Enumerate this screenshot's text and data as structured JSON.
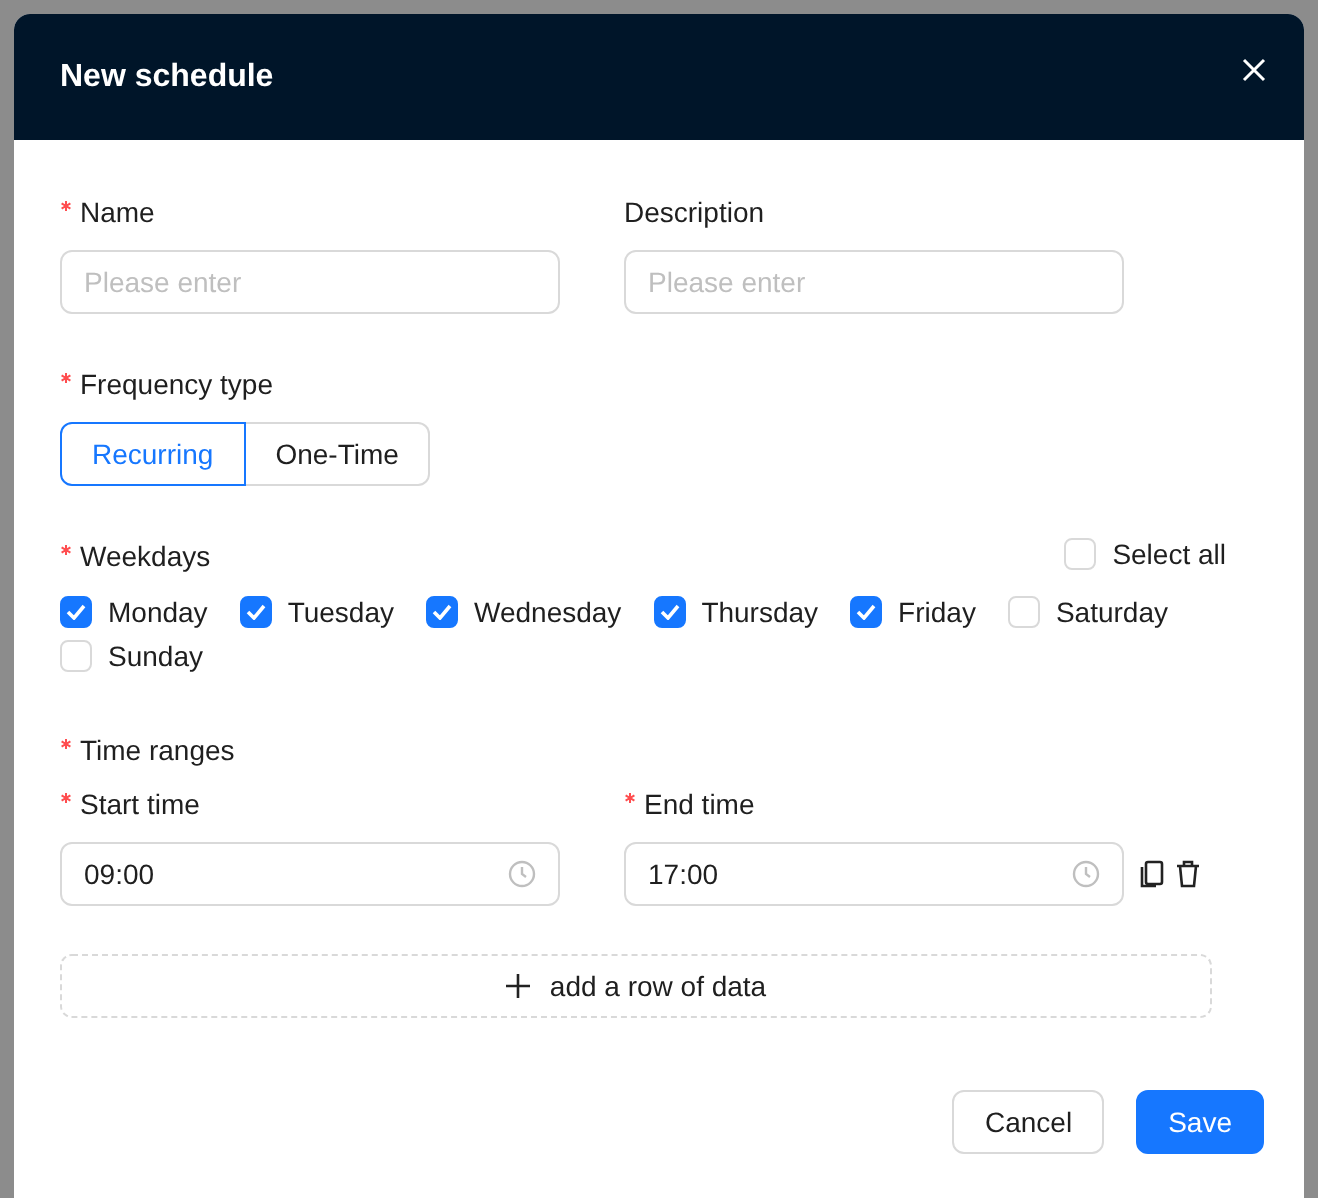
{
  "dialog": {
    "title": "New schedule"
  },
  "fields": [
    {
      "label": "Name",
      "required": true,
      "placeholder": "Please enter"
    },
    {
      "label": "Description",
      "required": false,
      "placeholder": "Please enter"
    }
  ],
  "frequency": {
    "label": "Frequency type",
    "required": true,
    "options": [
      {
        "label": "Recurring",
        "selected": true
      },
      {
        "label": "One-Time",
        "selected": false
      }
    ]
  },
  "weekdays": {
    "label": "Weekdays",
    "required": true,
    "select_all": {
      "label": "Select all",
      "checked": false
    },
    "days": [
      {
        "label": "Monday",
        "checked": true
      },
      {
        "label": "Tuesday",
        "checked": true
      },
      {
        "label": "Wednesday",
        "checked": true
      },
      {
        "label": "Thursday",
        "checked": true
      },
      {
        "label": "Friday",
        "checked": true
      },
      {
        "label": "Saturday",
        "checked": false
      },
      {
        "label": "Sunday",
        "checked": false
      }
    ]
  },
  "time_ranges": {
    "label": "Time ranges",
    "required": true,
    "columns": [
      {
        "label": "Start time",
        "required": true
      },
      {
        "label": "End time",
        "required": true
      }
    ],
    "rows": [
      {
        "start": "09:00",
        "end": "17:00"
      }
    ],
    "add_label": "add a row of data"
  },
  "buttons": [
    {
      "label": "Cancel",
      "kind": "default"
    },
    {
      "label": "Save",
      "kind": "primary"
    }
  ]
}
